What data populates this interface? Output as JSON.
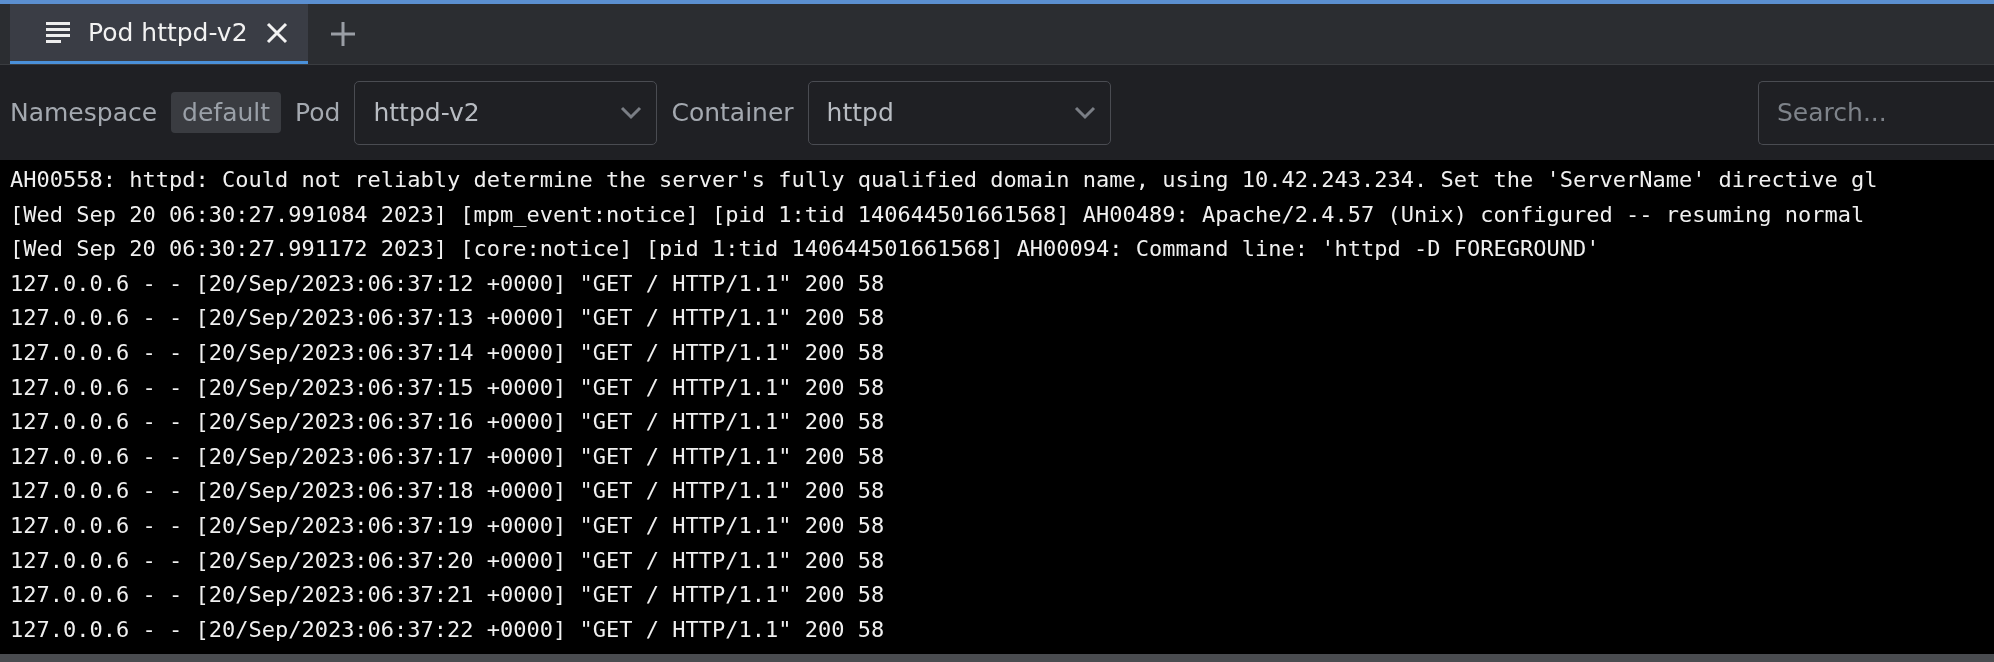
{
  "tabs": [
    {
      "label": "Pod httpd-v2",
      "selected": true
    }
  ],
  "toolbar": {
    "namespace_label": "Namespace",
    "namespace": "default",
    "pod_label": "Pod",
    "pod": "httpd-v2",
    "container_label": "Container",
    "container": "httpd",
    "search": {
      "placeholder": "Search..."
    }
  },
  "log_lines": [
    "AH00558: httpd: Could not reliably determine the server's fully qualified domain name, using 10.42.243.234. Set the 'ServerName' directive gl",
    "[Wed Sep 20 06:30:27.991084 2023] [mpm_event:notice] [pid 1:tid 140644501661568] AH00489: Apache/2.4.57 (Unix) configured -- resuming normal",
    "[Wed Sep 20 06:30:27.991172 2023] [core:notice] [pid 1:tid 140644501661568] AH00094: Command line: 'httpd -D FOREGROUND'",
    "127.0.0.6 - - [20/Sep/2023:06:37:12 +0000] \"GET / HTTP/1.1\" 200 58",
    "127.0.0.6 - - [20/Sep/2023:06:37:13 +0000] \"GET / HTTP/1.1\" 200 58",
    "127.0.0.6 - - [20/Sep/2023:06:37:14 +0000] \"GET / HTTP/1.1\" 200 58",
    "127.0.0.6 - - [20/Sep/2023:06:37:15 +0000] \"GET / HTTP/1.1\" 200 58",
    "127.0.0.6 - - [20/Sep/2023:06:37:16 +0000] \"GET / HTTP/1.1\" 200 58",
    "127.0.0.6 - - [20/Sep/2023:06:37:17 +0000] \"GET / HTTP/1.1\" 200 58",
    "127.0.0.6 - - [20/Sep/2023:06:37:18 +0000] \"GET / HTTP/1.1\" 200 58",
    "127.0.0.6 - - [20/Sep/2023:06:37:19 +0000] \"GET / HTTP/1.1\" 200 58",
    "127.0.0.6 - - [20/Sep/2023:06:37:20 +0000] \"GET / HTTP/1.1\" 200 58",
    "127.0.0.6 - - [20/Sep/2023:06:37:21 +0000] \"GET / HTTP/1.1\" 200 58",
    "127.0.0.6 - - [20/Sep/2023:06:37:22 +0000] \"GET / HTTP/1.1\" 200 58"
  ]
}
